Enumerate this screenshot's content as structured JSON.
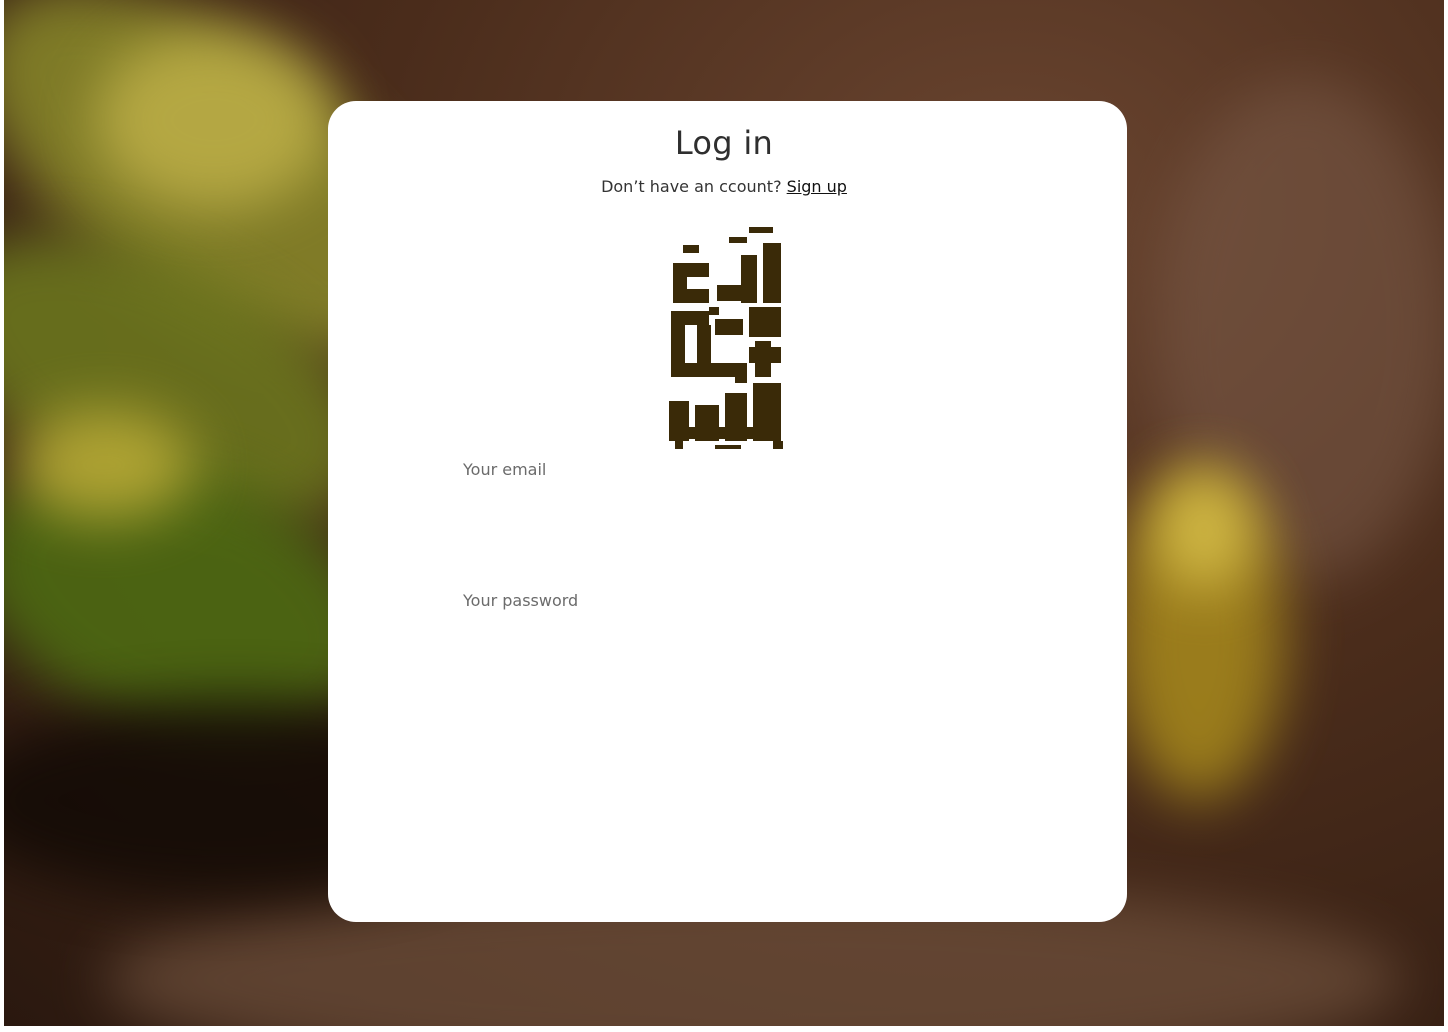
{
  "login": {
    "title": "Log in",
    "no_account_text": "Don’t have an ccount?",
    "signup_link": "Sign up",
    "logo_text": "أكاد من فرط الجمال",
    "email_label": "Your email",
    "email_value": "",
    "password_label": "Your password",
    "password_value": ""
  },
  "colors": {
    "logo": "#3a2a08",
    "card": "#ffffff",
    "title": "#2f2f2f"
  }
}
